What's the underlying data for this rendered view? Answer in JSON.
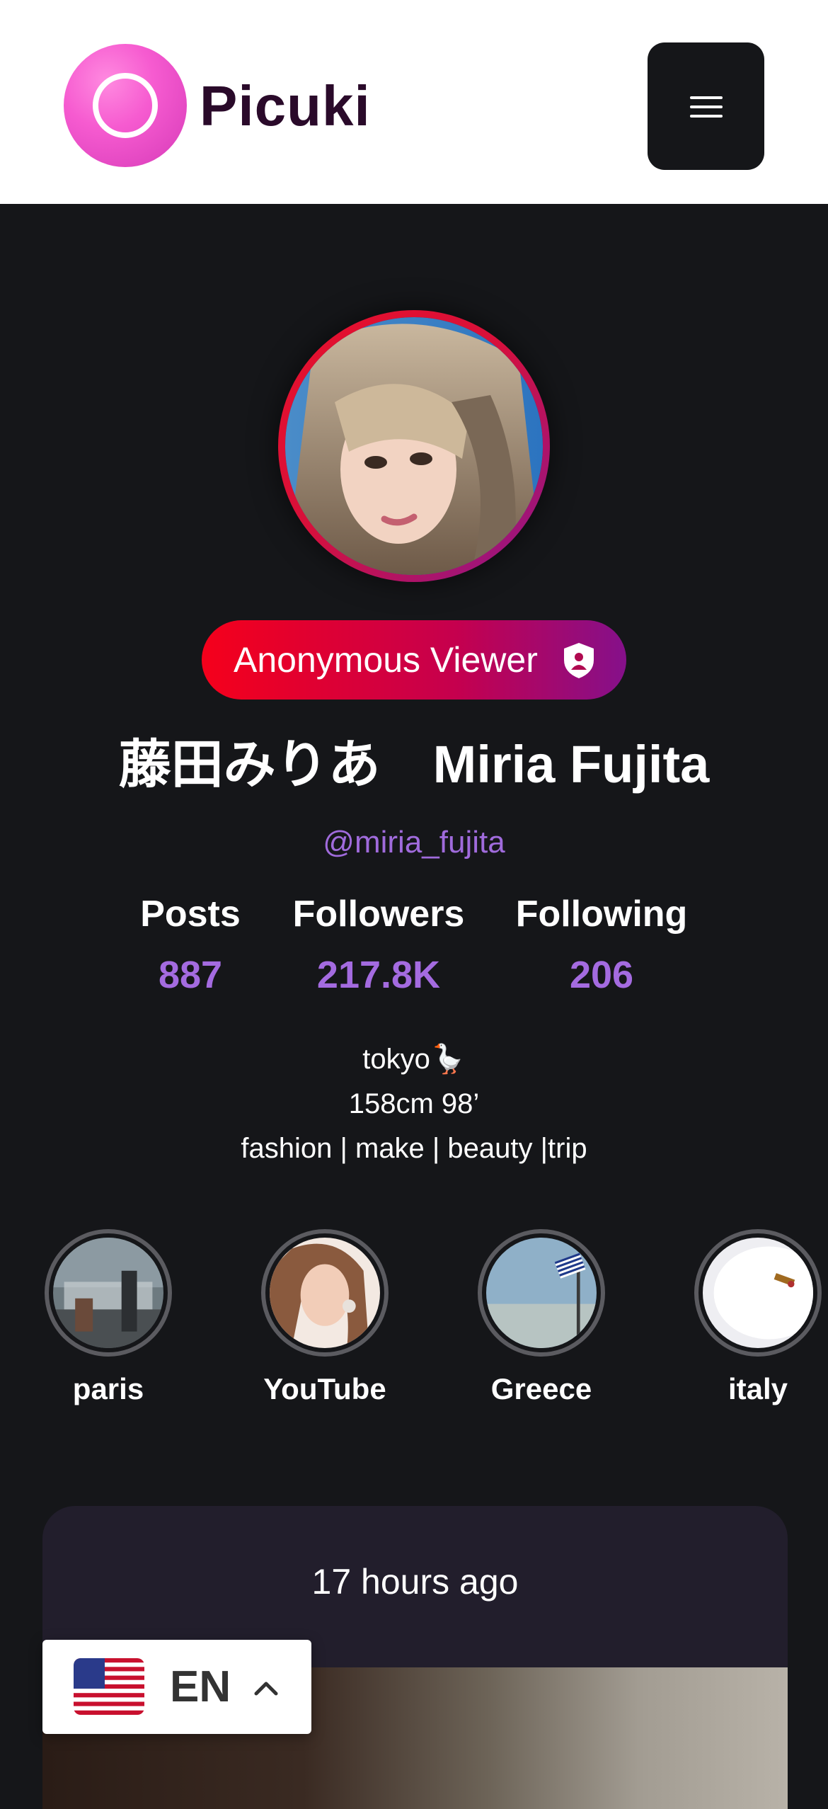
{
  "app": {
    "logo_text": "Picuki"
  },
  "profile": {
    "badge_label": "Anonymous Viewer",
    "display_name": "藤田みりあ　Miria Fujita",
    "handle": "@miria_fujita",
    "stats": [
      {
        "label": "Posts",
        "value": "887"
      },
      {
        "label": "Followers",
        "value": "217.8K"
      },
      {
        "label": "Following",
        "value": "206"
      }
    ],
    "bio": [
      "tokyo🪿",
      "158cm 98’",
      "fashion | make | beauty |trip"
    ]
  },
  "highlights": [
    {
      "label": "paris",
      "image": "street-scene"
    },
    {
      "label": "YouTube",
      "image": "portrait"
    },
    {
      "label": "Greece",
      "image": "flag-sky"
    },
    {
      "label": "italy",
      "image": "plate"
    }
  ],
  "post": {
    "time": "17 hours ago"
  },
  "language": {
    "code": "EN",
    "flag": "us-flag-icon"
  },
  "colors": {
    "background": "#151619",
    "accent": "#a46be0",
    "badge_start": "#f5001b",
    "badge_end": "#85108a"
  }
}
